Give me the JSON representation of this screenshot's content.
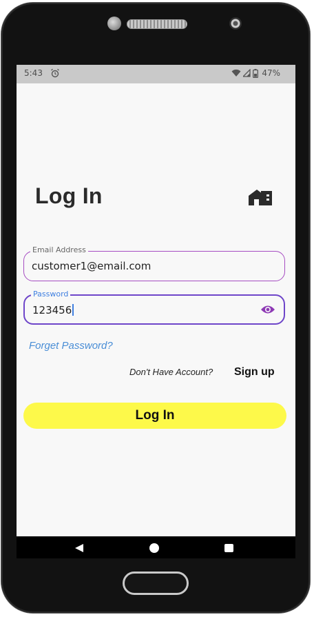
{
  "status_bar": {
    "time": "5:43",
    "battery_text": "47%",
    "icons": [
      "alarm-icon",
      "wifi-icon",
      "cell-signal-icon",
      "battery-icon"
    ]
  },
  "page": {
    "title": "Log In",
    "header_icon": "home-icon"
  },
  "email_field": {
    "label": "Email Address",
    "value": "customer1@email.com"
  },
  "password_field": {
    "label": "Password",
    "value": "123456",
    "toggle_icon": "eye-icon"
  },
  "links": {
    "forget_password": "Forget Password?",
    "account_prompt": "Don't Have Account?",
    "sign_up": "Sign up"
  },
  "login_button": {
    "label": "Log In"
  },
  "nav_bar": {
    "icons": [
      "back-icon",
      "home-circle-icon",
      "recents-icon"
    ]
  },
  "colors": {
    "accent_yellow": "#fdf94a",
    "email_border": "#a64cc2",
    "password_border": "#6e45c9",
    "link_blue": "#4a8ed6",
    "eye_purple": "#8e3ab5"
  }
}
